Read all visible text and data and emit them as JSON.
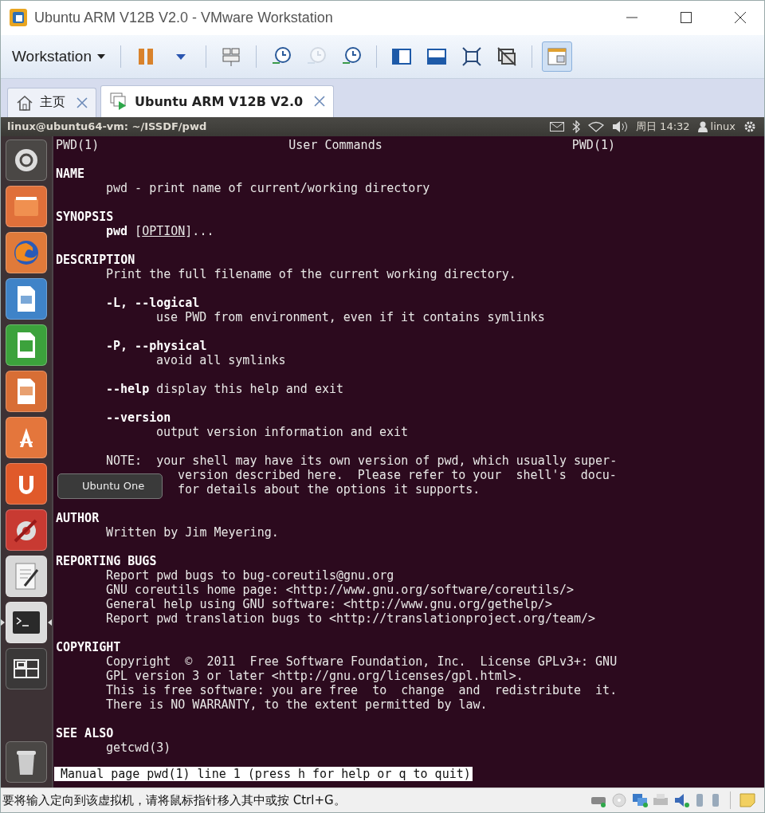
{
  "window": {
    "title": "Ubuntu ARM V12B V2.0 - VMware Workstation"
  },
  "toolbar": {
    "menu": "Workstation",
    "buttons": [
      {
        "kind": "pause",
        "disabled": false,
        "selected": false
      },
      {
        "kind": "dropdown",
        "disabled": false,
        "selected": false
      },
      {
        "kind": "send-keys",
        "disabled": false,
        "selected": false
      },
      {
        "kind": "snapshot-take",
        "disabled": false,
        "selected": false
      },
      {
        "kind": "snapshot-revert",
        "disabled": true,
        "selected": false
      },
      {
        "kind": "snapshot-manage",
        "disabled": false,
        "selected": false
      },
      {
        "kind": "sidebar",
        "disabled": false,
        "selected": false
      },
      {
        "kind": "thumbnail",
        "disabled": false,
        "selected": false
      },
      {
        "kind": "fullscreen",
        "disabled": false,
        "selected": false
      },
      {
        "kind": "unity",
        "disabled": false,
        "selected": false
      },
      {
        "kind": "console-view",
        "disabled": false,
        "selected": true
      }
    ]
  },
  "tabs": [
    {
      "label": "主页",
      "kind": "home",
      "selected": false
    },
    {
      "label": "Ubuntu ARM V12B V2.0",
      "kind": "vm",
      "selected": true
    }
  ],
  "panel": {
    "title": "linux@ubuntu64-vm: ~/ISSDF/pwd",
    "clock": "周日 14:32",
    "user": "linux"
  },
  "launcher": [
    {
      "kind": "dash",
      "active": false
    },
    {
      "kind": "files",
      "active": false
    },
    {
      "kind": "browser",
      "active": false
    },
    {
      "kind": "writer",
      "active": false
    },
    {
      "kind": "calc",
      "active": false
    },
    {
      "kind": "impress",
      "active": false
    },
    {
      "kind": "software",
      "active": false
    },
    {
      "kind": "ubuntu-one",
      "active": false
    },
    {
      "kind": "settings",
      "active": false
    },
    {
      "kind": "editor",
      "active": false
    },
    {
      "kind": "terminal",
      "active": true
    },
    {
      "kind": "workspaces",
      "active": false
    },
    {
      "kind": "trash",
      "active": false
    }
  ],
  "tooltip": "Ubuntu One",
  "man": {
    "header": {
      "left": "PWD(1)",
      "center": "User Commands",
      "right": "PWD(1)"
    },
    "sections": [
      {
        "heading": "NAME",
        "paragraphs": [
          {
            "lines": [
              {
                "segments": [
                  {
                    "text": "pwd - print name of current/working directory",
                    "kind": "plain"
                  }
                ]
              }
            ]
          }
        ]
      },
      {
        "heading": "SYNOPSIS",
        "paragraphs": [
          {
            "lines": [
              {
                "segments": [
                  {
                    "text": "pwd",
                    "kind": "bold"
                  },
                  {
                    "text": " [",
                    "kind": "plain"
                  },
                  {
                    "text": "OPTION",
                    "kind": "underline"
                  },
                  {
                    "text": "]...",
                    "kind": "plain"
                  }
                ]
              }
            ]
          }
        ]
      },
      {
        "heading": "DESCRIPTION",
        "paragraphs": [
          {
            "lines": [
              {
                "segments": [
                  {
                    "text": "Print the full filename of the current working directory.",
                    "kind": "plain"
                  }
                ]
              }
            ]
          },
          {
            "lines": [
              {
                "segments": [
                  {
                    "text": "-L, --logical",
                    "kind": "bold"
                  }
                ],
                "children": [
                  {
                    "segments": [
                      {
                        "text": "use PWD from environment, even if it contains symlinks",
                        "kind": "plain"
                      }
                    ]
                  }
                ]
              }
            ]
          },
          {
            "lines": [
              {
                "segments": [
                  {
                    "text": "-P, --physical",
                    "kind": "bold"
                  }
                ],
                "children": [
                  {
                    "segments": [
                      {
                        "text": "avoid all symlinks",
                        "kind": "plain"
                      }
                    ]
                  }
                ]
              }
            ]
          },
          {
            "lines": [
              {
                "segments": [
                  {
                    "text": "--help",
                    "kind": "bold"
                  },
                  {
                    "text": " display this help and exit",
                    "kind": "plain"
                  }
                ]
              }
            ]
          },
          {
            "lines": [
              {
                "segments": [
                  {
                    "text": "--version",
                    "kind": "bold"
                  }
                ],
                "children": [
                  {
                    "segments": [
                      {
                        "text": "output version information and exit",
                        "kind": "plain"
                      }
                    ]
                  }
                ]
              }
            ]
          },
          {
            "lines": [
              {
                "segments": [
                  {
                    "text": "NOTE:  your shell may have its own version of pwd, which usually super-",
                    "kind": "plain"
                  }
                ]
              }
            ],
            "lines_right_of_tooltip": [
              {
                "segments": [
                  {
                    "text": "version described here.  Please refer to your  shell's  docu-",
                    "kind": "plain"
                  }
                ]
              },
              {
                "segments": [
                  {
                    "text": "for details about the options it supports.",
                    "kind": "plain"
                  }
                ]
              }
            ]
          }
        ]
      },
      {
        "heading": "AUTHOR",
        "paragraphs": [
          {
            "lines": [
              {
                "segments": [
                  {
                    "text": "Written by Jim Meyering.",
                    "kind": "plain"
                  }
                ]
              }
            ]
          }
        ]
      },
      {
        "heading": "REPORTING BUGS",
        "paragraphs": [
          {
            "lines": [
              {
                "segments": [
                  {
                    "text": "Report pwd bugs to bug-coreutils@gnu.org",
                    "kind": "plain"
                  }
                ]
              },
              {
                "segments": [
                  {
                    "text": "GNU coreutils home page: <http://www.gnu.org/software/coreutils/>",
                    "kind": "plain"
                  }
                ]
              },
              {
                "segments": [
                  {
                    "text": "General help using GNU software: <http://www.gnu.org/gethelp/>",
                    "kind": "plain"
                  }
                ]
              },
              {
                "segments": [
                  {
                    "text": "Report pwd translation bugs to <http://translationproject.org/team/>",
                    "kind": "plain"
                  }
                ]
              }
            ]
          }
        ]
      },
      {
        "heading": "COPYRIGHT",
        "paragraphs": [
          {
            "lines": [
              {
                "segments": [
                  {
                    "text": "Copyright  ©  2011  Free Software Foundation, Inc.  License GPLv3+: GNU",
                    "kind": "plain"
                  }
                ]
              },
              {
                "segments": [
                  {
                    "text": "GPL version 3 or later <http://gnu.org/licenses/gpl.html>.",
                    "kind": "plain"
                  }
                ]
              },
              {
                "segments": [
                  {
                    "text": "This is free software: you are free  to  change  and  redistribute  it.",
                    "kind": "plain"
                  }
                ]
              },
              {
                "segments": [
                  {
                    "text": "There is NO WARRANTY, to the extent permitted by law.",
                    "kind": "plain"
                  }
                ]
              }
            ]
          }
        ]
      },
      {
        "heading": "SEE ALSO",
        "paragraphs": [
          {
            "lines": [
              {
                "segments": [
                  {
                    "text": "getcwd(3)",
                    "kind": "plain"
                  }
                ]
              }
            ]
          }
        ]
      }
    ],
    "status": "Manual page pwd(1) line 1 (press h for help or q to quit)"
  },
  "status_bar": {
    "message": "要将输入定向到该虚拟机，请将鼠标指针移入其中或按 Ctrl+G。"
  }
}
